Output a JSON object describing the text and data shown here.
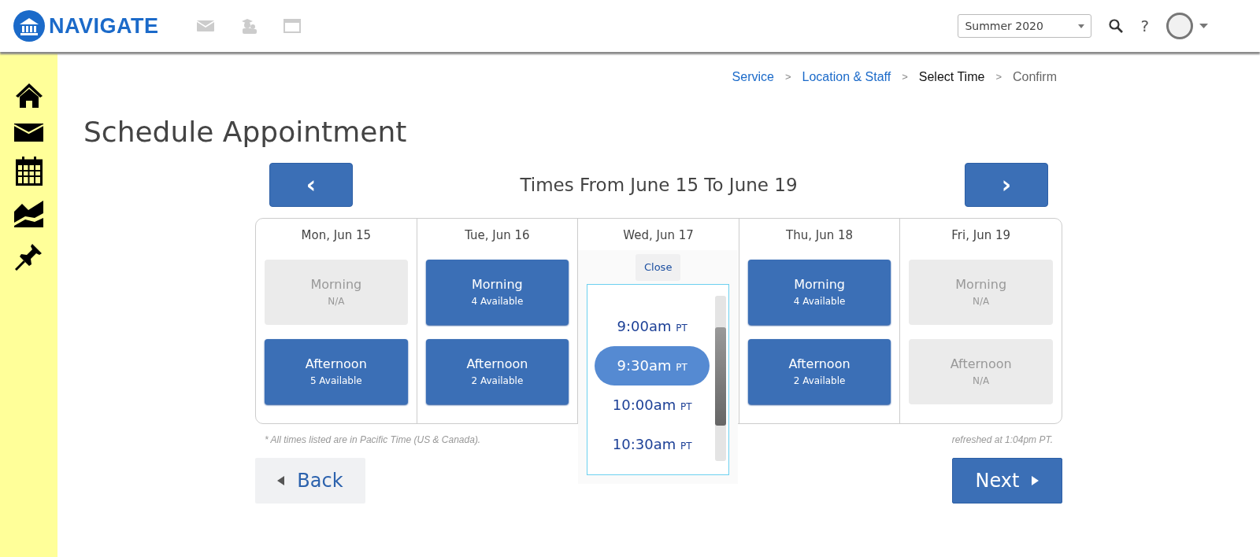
{
  "header": {
    "logo": "NAVIGATE",
    "term_select": {
      "value": "Summer 2020"
    },
    "help": "?"
  },
  "breadcrumb": [
    {
      "label": "Service",
      "kind": "link"
    },
    {
      "label": "Location & Staff",
      "kind": "link"
    },
    {
      "label": "Select Time",
      "kind": "current"
    },
    {
      "label": "Confirm",
      "kind": "upcoming"
    }
  ],
  "breadcrumb_separator": ">",
  "page_title": "Schedule Appointment",
  "week": {
    "prev": "‹",
    "title": "Times From June 15 To June 19",
    "next": "›"
  },
  "days": [
    {
      "label": "Mon, Jun 15",
      "kind": "slots",
      "slots": [
        {
          "label": "Morning",
          "availability": "N/A",
          "available": false
        },
        {
          "label": "Afternoon",
          "availability": "5 Available",
          "available": true
        }
      ]
    },
    {
      "label": "Tue, Jun 16",
      "kind": "slots",
      "slots": [
        {
          "label": "Morning",
          "availability": "4 Available",
          "available": true
        },
        {
          "label": "Afternoon",
          "availability": "2 Available",
          "available": true
        }
      ]
    },
    {
      "label": "Wed, Jun 17",
      "kind": "picker",
      "close": "Close",
      "times": [
        {
          "time": "9:00am",
          "zone": "PT",
          "selected": false
        },
        {
          "time": "9:30am",
          "zone": "PT",
          "selected": true
        },
        {
          "time": "10:00am",
          "zone": "PT",
          "selected": false
        },
        {
          "time": "10:30am",
          "zone": "PT",
          "selected": false
        }
      ]
    },
    {
      "label": "Thu, Jun 18",
      "kind": "slots",
      "slots": [
        {
          "label": "Morning",
          "availability": "4 Available",
          "available": true
        },
        {
          "label": "Afternoon",
          "availability": "2 Available",
          "available": true
        }
      ]
    },
    {
      "label": "Fri, Jun 19",
      "kind": "slots",
      "slots": [
        {
          "label": "Morning",
          "availability": "N/A",
          "available": false
        },
        {
          "label": "Afternoon",
          "availability": "N/A",
          "available": false
        }
      ]
    }
  ],
  "timezone_note": "* All times listed are in Pacific Time (US & Canada).",
  "refreshed_note": "refreshed at 1:04pm PT.",
  "back_button": "Back",
  "next_button": "Next"
}
